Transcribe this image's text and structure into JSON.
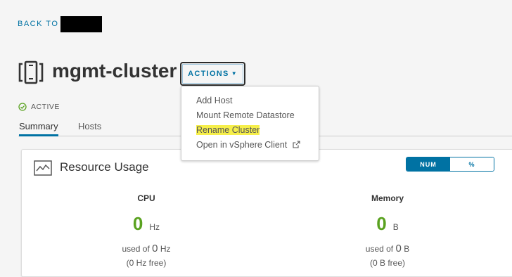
{
  "nav": {
    "back_label": "BACK TO"
  },
  "header": {
    "title": "mgmt-cluster",
    "actions_label": "ACTIONS",
    "status": "ACTIVE"
  },
  "tabs": [
    {
      "label": "Summary",
      "active": true
    },
    {
      "label": "Hosts",
      "active": false
    }
  ],
  "actions_menu": {
    "items": [
      {
        "label": "Add Host"
      },
      {
        "label": "Mount Remote Datastore"
      },
      {
        "label": "Rename Cluster",
        "highlighted": true
      },
      {
        "label": "Open in vSphere Client",
        "external": true
      }
    ]
  },
  "resource_usage": {
    "title": "Resource Usage",
    "toggle": {
      "options": [
        "NUM",
        "%"
      ],
      "selected": "NUM"
    },
    "cpu": {
      "name": "CPU",
      "value": "0",
      "unit": "Hz",
      "used_prefix": "used of",
      "used_value": "0",
      "used_unit": "Hz",
      "free": "(0 Hz free)"
    },
    "memory": {
      "name": "Memory",
      "value": "0",
      "unit": "B",
      "used_prefix": "used of",
      "used_value": "0",
      "used_unit": "B",
      "free": "(0 B free)"
    }
  },
  "colors": {
    "accent": "#0072a3",
    "metric_value": "#5aa220",
    "status_ok": "#5aa220",
    "highlight": "#f6ef4a"
  }
}
